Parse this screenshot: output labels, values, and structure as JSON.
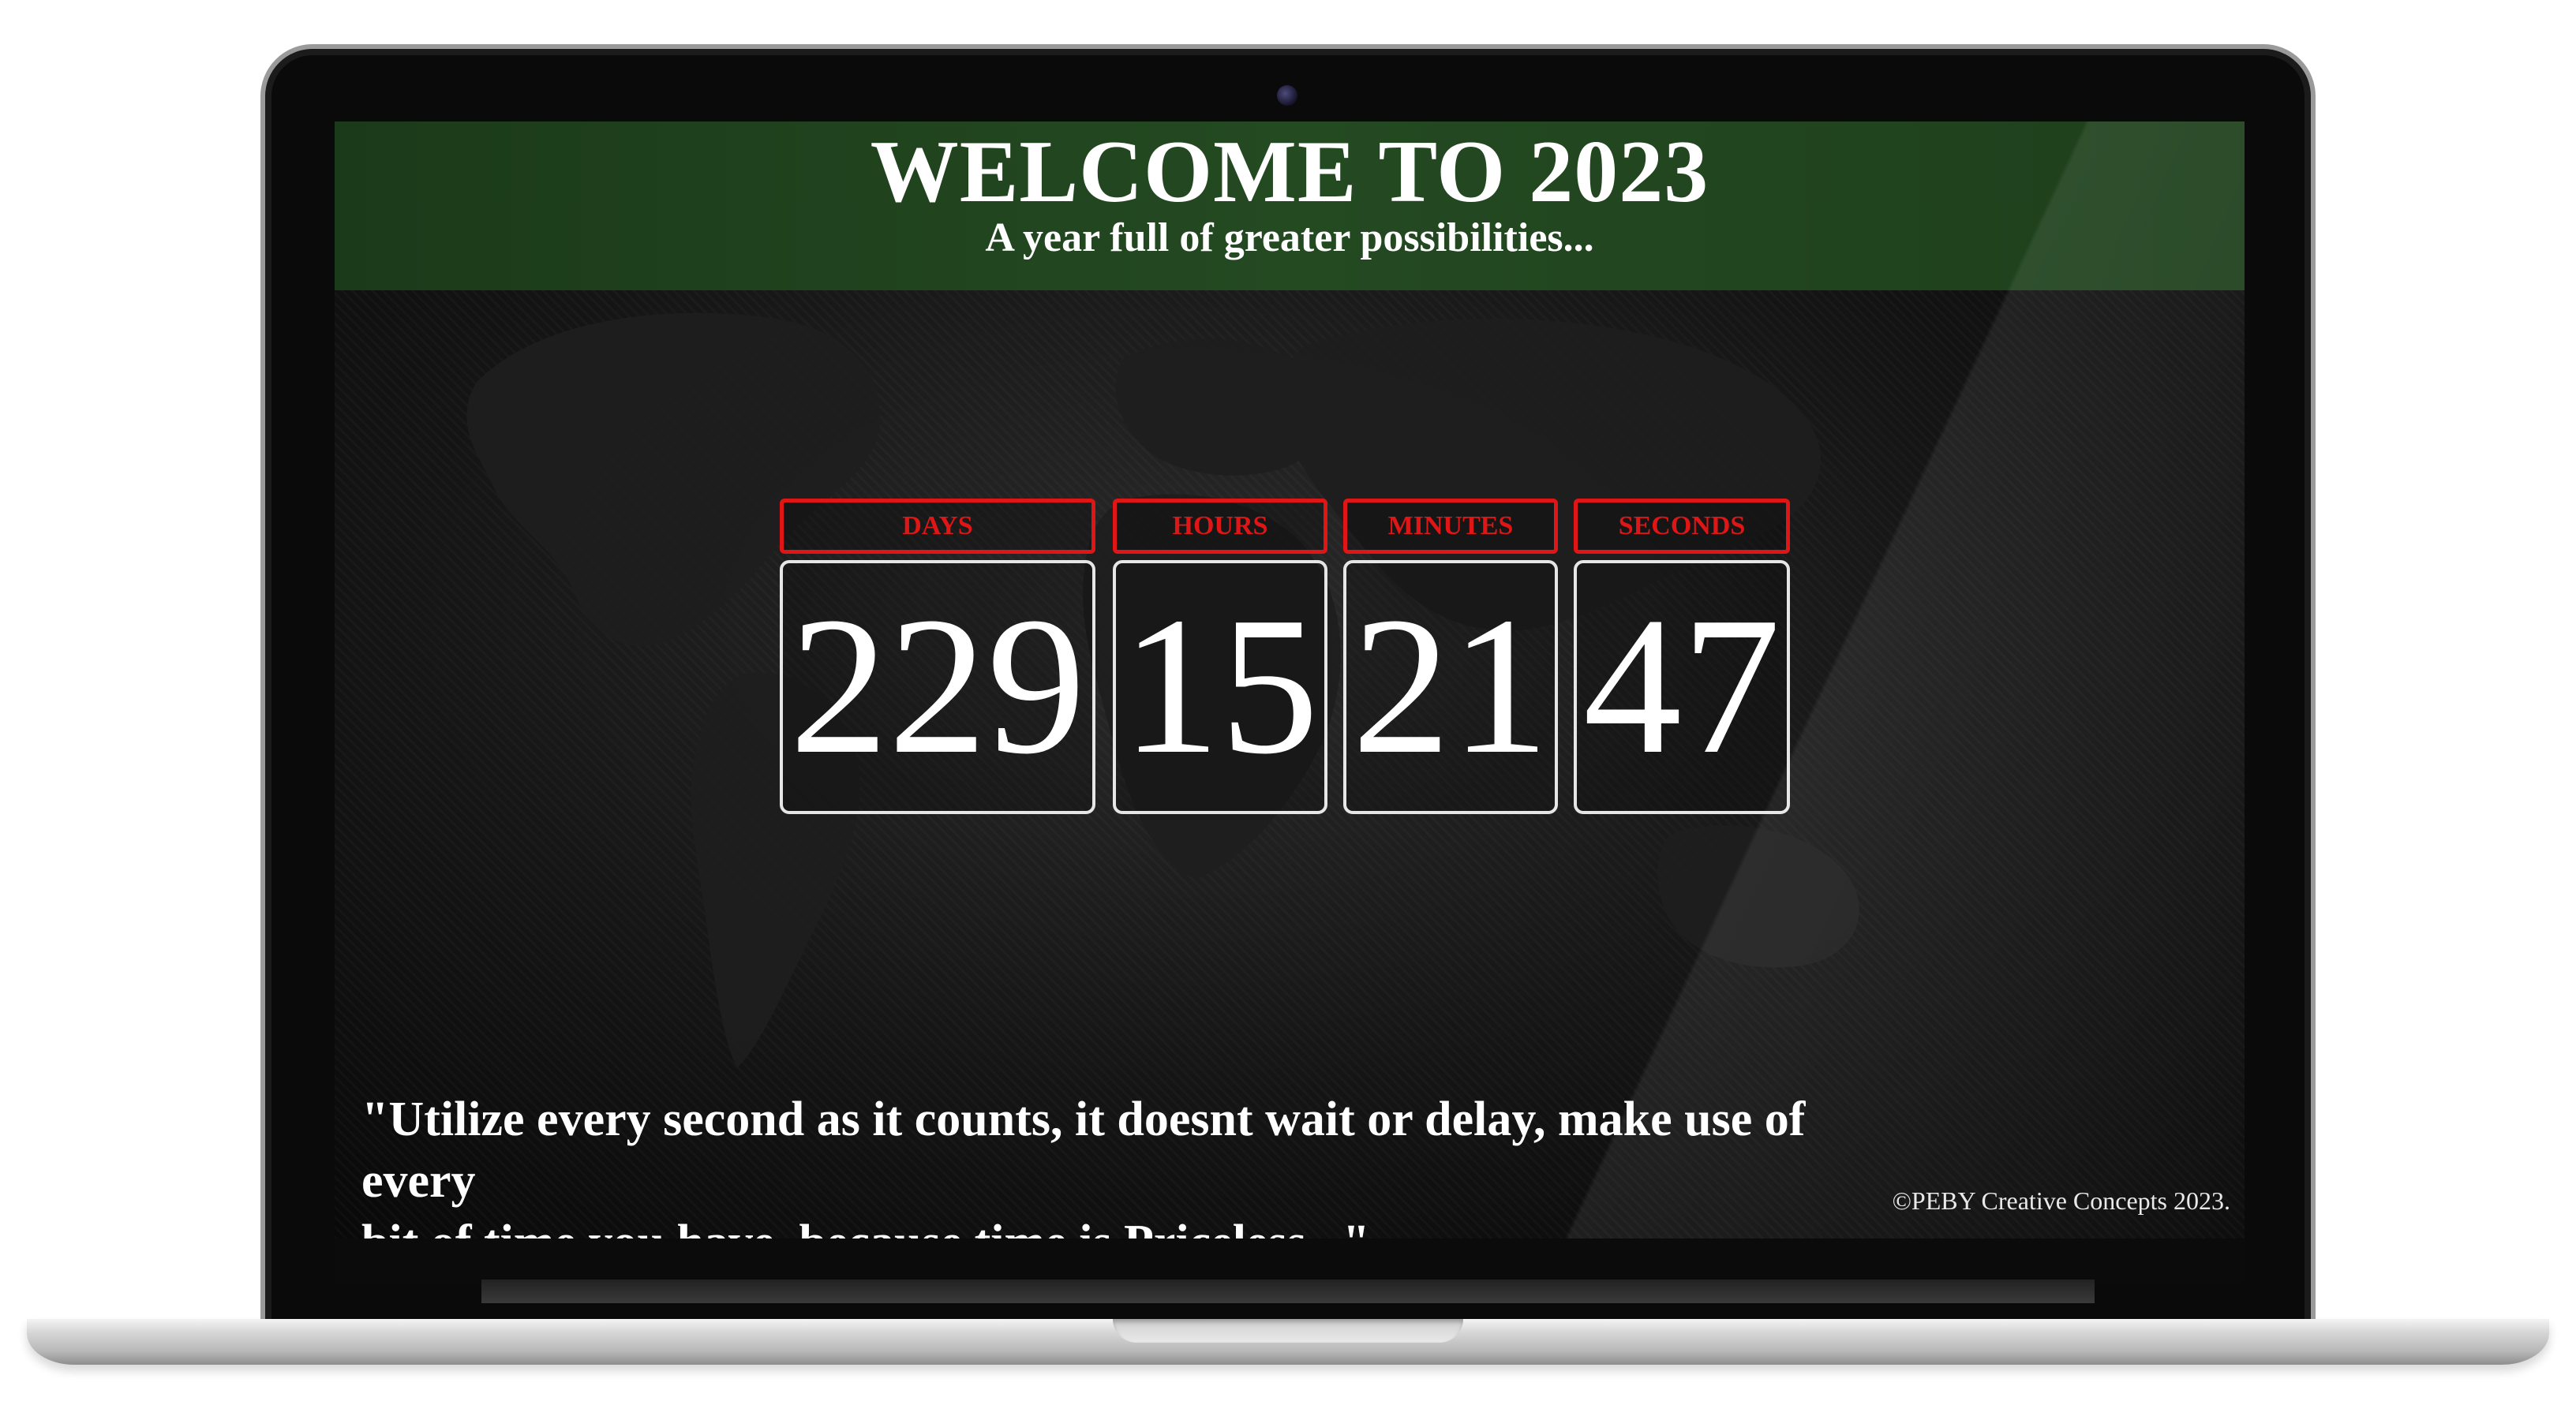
{
  "header": {
    "title": "WELCOME TO 2023",
    "subtitle": "A year full of greater possibilities..."
  },
  "countdown": [
    {
      "label": "DAYS",
      "value": "229"
    },
    {
      "label": "HOURS",
      "value": "15"
    },
    {
      "label": "MINUTES",
      "value": "21"
    },
    {
      "label": "SECONDS",
      "value": "47"
    }
  ],
  "quote": {
    "line1": "\"Utilize every second as it counts, it doesnt wait or delay, make use of every",
    "line2": "bit of time you have, because time is Priceless...\""
  },
  "footer": {
    "copyright": "©PEBY Creative Concepts 2023."
  },
  "colors": {
    "header_band": "#244a22",
    "label_red": "#e01515",
    "digit_white": "#ffffff",
    "background": "#141414"
  }
}
